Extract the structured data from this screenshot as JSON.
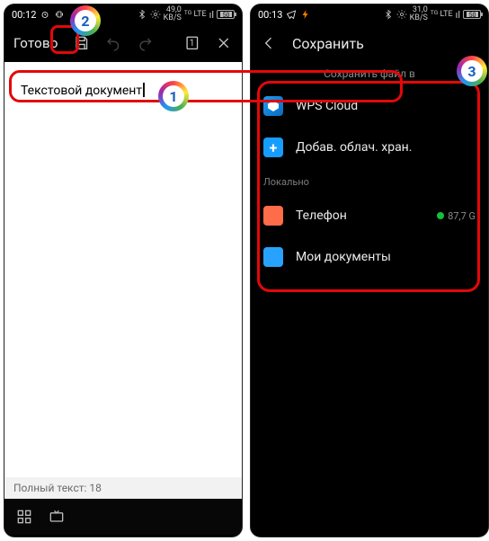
{
  "left": {
    "status": {
      "time": "00:12",
      "rate_value": "49,0",
      "rate_unit": "KB/S",
      "net": "ᵀᴳ LTE",
      "signal": "ıl",
      "batt": "50"
    },
    "appbar": {
      "done": "Готово",
      "save_icon": "save",
      "undo_icon": "undo",
      "redo_icon": "redo",
      "page_indicator": "1",
      "close_icon": "close"
    },
    "document": {
      "text": "Текстовой документ"
    },
    "footer": {
      "full_text_label": "Полный текст: 18"
    }
  },
  "right": {
    "status": {
      "time": "00:13",
      "rate_value": "31,0",
      "rate_unit": "KB/S",
      "net": "ᵀᴳ LTE",
      "signal": "ıl",
      "batt": "50"
    },
    "appbar": {
      "back_icon": "back",
      "title": "Сохранить"
    },
    "subheader": "Сохранить файл в",
    "items": [
      {
        "icon": "wps",
        "label": "WPS Cloud"
      },
      {
        "icon": "plus",
        "label": "Добав. облач. хран."
      }
    ],
    "section_local": "Локально",
    "local_items": [
      {
        "icon": "phone",
        "label": "Телефон",
        "meta": "87,7 G"
      },
      {
        "icon": "folder",
        "label": "Мои документы"
      }
    ]
  },
  "badges": {
    "one": "1",
    "two": "2",
    "three": "3"
  }
}
